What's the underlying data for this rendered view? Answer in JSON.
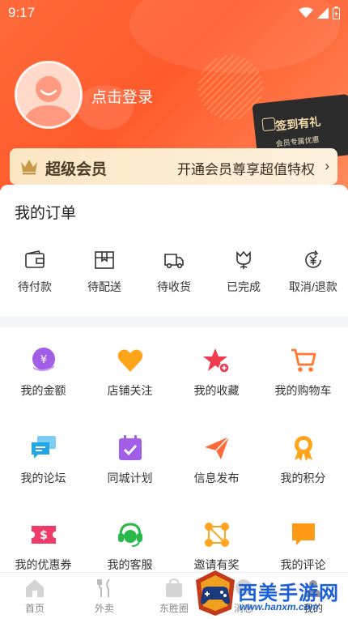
{
  "status_bar": {
    "time": "9:17"
  },
  "profile": {
    "login_label": "点击登录"
  },
  "checkin": {
    "title": "签到有礼",
    "subtitle": "会员专属优惠"
  },
  "vip": {
    "title": "超级会员",
    "promo": "开通会员尊享超值特权",
    "chevron": "›"
  },
  "orders": {
    "title": "我的订单",
    "items": [
      {
        "label": "待付款",
        "icon": "wallet-icon"
      },
      {
        "label": "待配送",
        "icon": "package-icon"
      },
      {
        "label": "待收货",
        "icon": "truck-icon"
      },
      {
        "label": "已完成",
        "icon": "tulip-icon"
      },
      {
        "label": "取消/退款",
        "icon": "refund-icon"
      }
    ]
  },
  "services": [
    {
      "label": "我的金额",
      "icon": "yuan-coin-icon",
      "color": "#a35ee8"
    },
    {
      "label": "店铺关注",
      "icon": "heart-icon",
      "color": "#ffa41b"
    },
    {
      "label": "我的收藏",
      "icon": "star-plus-icon",
      "color": "#ef3a4f"
    },
    {
      "label": "我的购物车",
      "icon": "cart-icon",
      "color": "#ff7a30"
    },
    {
      "label": "我的论坛",
      "icon": "chat-bubbles-icon",
      "color": "#22a7e6"
    },
    {
      "label": "同城计划",
      "icon": "calendar-check-icon",
      "color": "#a35ee8"
    },
    {
      "label": "信息发布",
      "icon": "paper-plane-icon",
      "color": "#ff6a3a"
    },
    {
      "label": "我的积分",
      "icon": "medal-icon",
      "color": "#ffa41b"
    },
    {
      "label": "我的优惠券",
      "icon": "coupon-icon",
      "color": "#ef3a6a"
    },
    {
      "label": "我的客服",
      "icon": "headset-icon",
      "color": "#29b84a"
    },
    {
      "label": "邀请有奖",
      "icon": "network-icon",
      "color": "#ffa41b"
    },
    {
      "label": "我的评论",
      "icon": "comment-icon",
      "color": "#ff9a16"
    }
  ],
  "bottom_nav": [
    {
      "label": "首页",
      "icon": "home-icon"
    },
    {
      "label": "外卖",
      "icon": "cutlery-icon"
    },
    {
      "label": "东胜圈",
      "icon": "bag-icon"
    },
    {
      "label": "消息",
      "icon": "message-icon"
    },
    {
      "label": "我的",
      "icon": "profile-icon"
    }
  ],
  "watermark": {
    "text": "西美手游网",
    "url": "www.hanxm.com"
  },
  "colors": {
    "brand": "#ff5a2c",
    "vip_gold": "#fbe6c4"
  }
}
